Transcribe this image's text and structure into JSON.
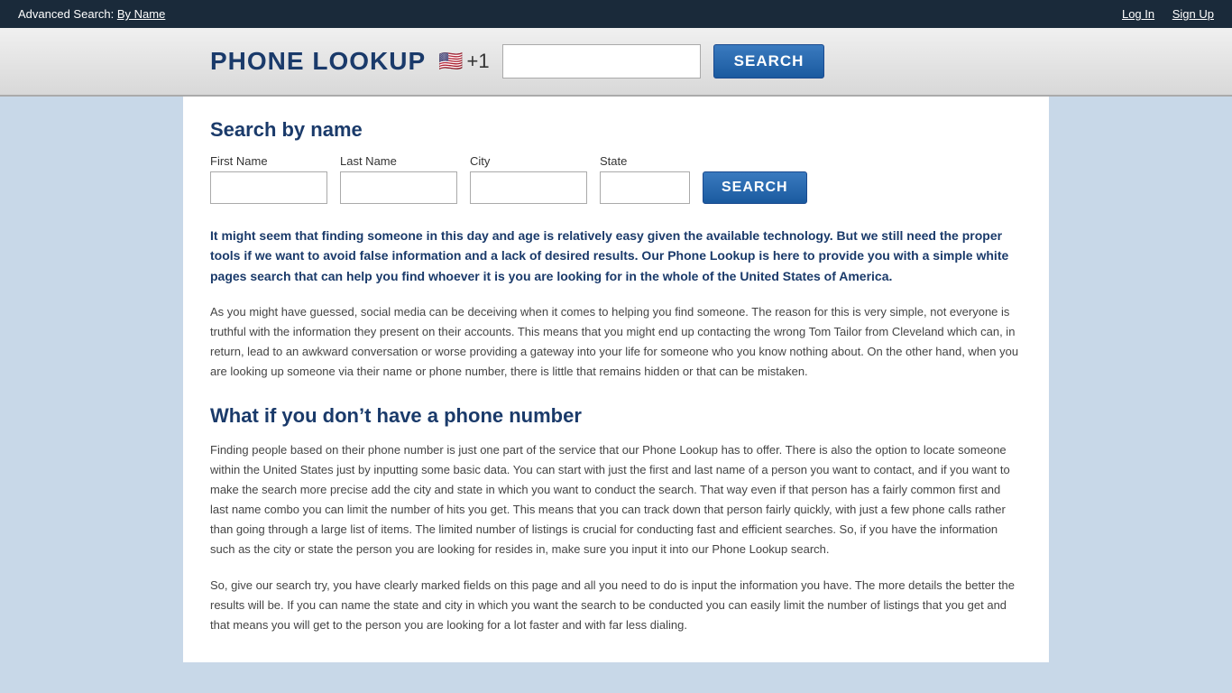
{
  "topnav": {
    "advanced_search_label": "Advanced Search:",
    "by_name_link": "By Name",
    "login_link": "Log In",
    "signup_link": "Sign Up"
  },
  "phone_lookup": {
    "title": "PHONE LOOKUP",
    "flag_emoji": "🇺🇸",
    "country_code": "+1",
    "input_placeholder": "",
    "search_button": "SEARCH"
  },
  "search_by_name": {
    "section_title": "Search by name",
    "first_name_label": "First Name",
    "last_name_label": "Last Name",
    "city_label": "City",
    "state_label": "State",
    "search_button": "SEARCH"
  },
  "body": {
    "intro_bold": "It might seem that finding someone in this day and age is relatively easy given the available technology. But we still need the proper tools if we want to avoid false information and a lack of desired results. Our Phone Lookup is here to provide you with a simple white pages search that can help you find whoever it is you are looking for in the whole of the United States of America.",
    "intro_normal": "As you might have guessed, social media can be deceiving when it comes to helping you find someone. The reason for this is very simple, not everyone is truthful with the information they present on their accounts. This means that you might end up contacting the wrong Tom Tailor from Cleveland which can, in return, lead to an awkward conversation or worse providing a gateway into your life for someone who you know nothing about. On the other hand, when you are looking up someone via their name or phone number, there is little that remains hidden or that can be mistaken.",
    "section2_title": "What if you don’t have a phone number",
    "section2_body": "Finding people based on their phone number is just one part of the service that our Phone Lookup has to offer. There is also the option to locate someone within the United States just by inputting some basic data. You can start with just the first and last name of a person you want to contact, and if you want to make the search more precise add the city and state in which you want to conduct the search. That way even if that person has a fairly common first and last name combo you can limit the number of hits you get. This means that you can track down that person fairly quickly, with just a few phone calls rather than going through a large list of items. The limited number of listings is crucial for conducting fast and efficient searches. So, if you have the information such as the city or state the person you are looking for resides in, make sure you input it into our Phone Lookup search.",
    "section3_body": "So, give our search try, you have clearly marked fields on this page and all you need to do is input the information you have. The more details the better the results will be. If you can name the state and city in which you want the search to be conducted you can easily limit the number of listings that you get and that means you will get to the person you are looking for a lot faster and with far less dialing."
  }
}
